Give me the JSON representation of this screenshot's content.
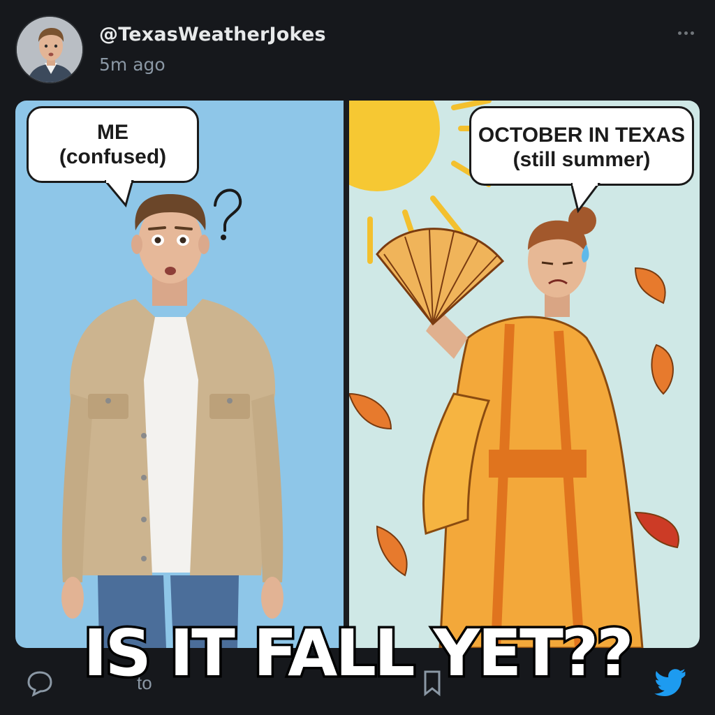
{
  "post": {
    "handle": "@TexasWeatherJokes",
    "timestamp": "5m ago"
  },
  "meme": {
    "left_bubble": {
      "line1": "ME",
      "line2": "(confused)"
    },
    "right_bubble": {
      "line1": "OCTOBER IN TEXAS",
      "line2": "(still summer)"
    },
    "question_mark": "?",
    "caption": "IS IT FALL YET??"
  },
  "actions": {
    "reply_icon": "speech-bubble-icon",
    "share_label": "to",
    "brand_icon": "twitter-bird-icon"
  },
  "colors": {
    "background": "#16181c",
    "left_panel": "#8ec6e8",
    "right_panel": "#cfe8e6",
    "twitter_blue": "#1d9bf0"
  }
}
